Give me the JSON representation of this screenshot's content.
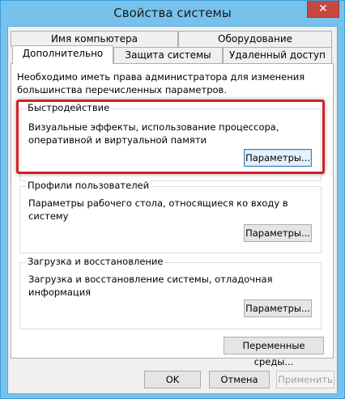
{
  "window": {
    "title": "Свойства системы",
    "close_glyph": "✕"
  },
  "tabs": {
    "row1": [
      "Имя компьютера",
      "Оборудование"
    ],
    "row2": [
      "Дополнительно",
      "Защита системы",
      "Удаленный доступ"
    ],
    "active": "Дополнительно"
  },
  "panel": {
    "intro": "Необходимо иметь права администратора для изменения большинства перечисленных параметров.",
    "performance": {
      "title": "Быстродействие",
      "description": "Визуальные эффекты, использование процессора, оперативной и виртуальной памяти",
      "button": "Параметры..."
    },
    "profiles": {
      "title": "Профили пользователей",
      "description": "Параметры рабочего стола, относящиеся ко входу в систему",
      "button": "Параметры..."
    },
    "startup": {
      "title": "Загрузка и восстановление",
      "description": "Загрузка и восстановление системы, отладочная информация",
      "button": "Параметры..."
    },
    "env_button": "Переменные среды..."
  },
  "footer": {
    "ok": "OK",
    "cancel": "Отмена",
    "apply": "Применить"
  },
  "colors": {
    "frame": "#77c2ec",
    "close": "#c7463d",
    "highlight": "#d21f26"
  }
}
